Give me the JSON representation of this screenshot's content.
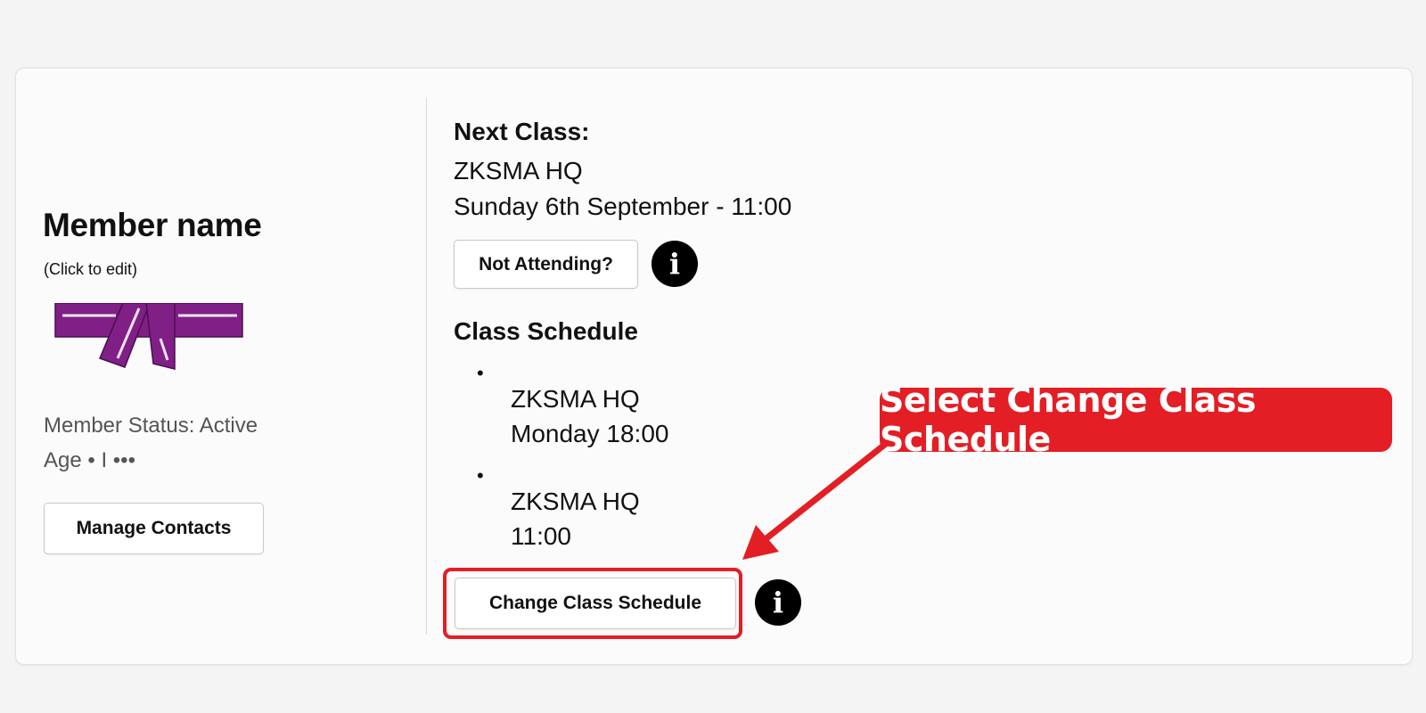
{
  "member": {
    "name": "Member name",
    "edit_hint": "(Click to edit)",
    "status": "Member Status: Active",
    "age": "Age  • I •••",
    "manage_contacts_label": "Manage Contacts",
    "belt_color": "#801f86"
  },
  "next_class": {
    "heading": "Next Class:",
    "location": "ZKSMA HQ",
    "datetime": "Sunday 6th September - 11:00",
    "not_attending_label": "Not Attending?",
    "info_glyph": "i"
  },
  "schedule": {
    "heading": "Class Schedule",
    "items": [
      {
        "bullet": "•",
        "location": "ZKSMA HQ",
        "time": "Monday 18:00"
      },
      {
        "bullet": "•",
        "location": "ZKSMA HQ",
        "time": "11:00"
      }
    ],
    "change_label": "Change Class Schedule",
    "info_glyph": "i"
  },
  "annotation": {
    "callout_text": "Select Change Class Schedule",
    "accent_color": "#e31e24"
  }
}
